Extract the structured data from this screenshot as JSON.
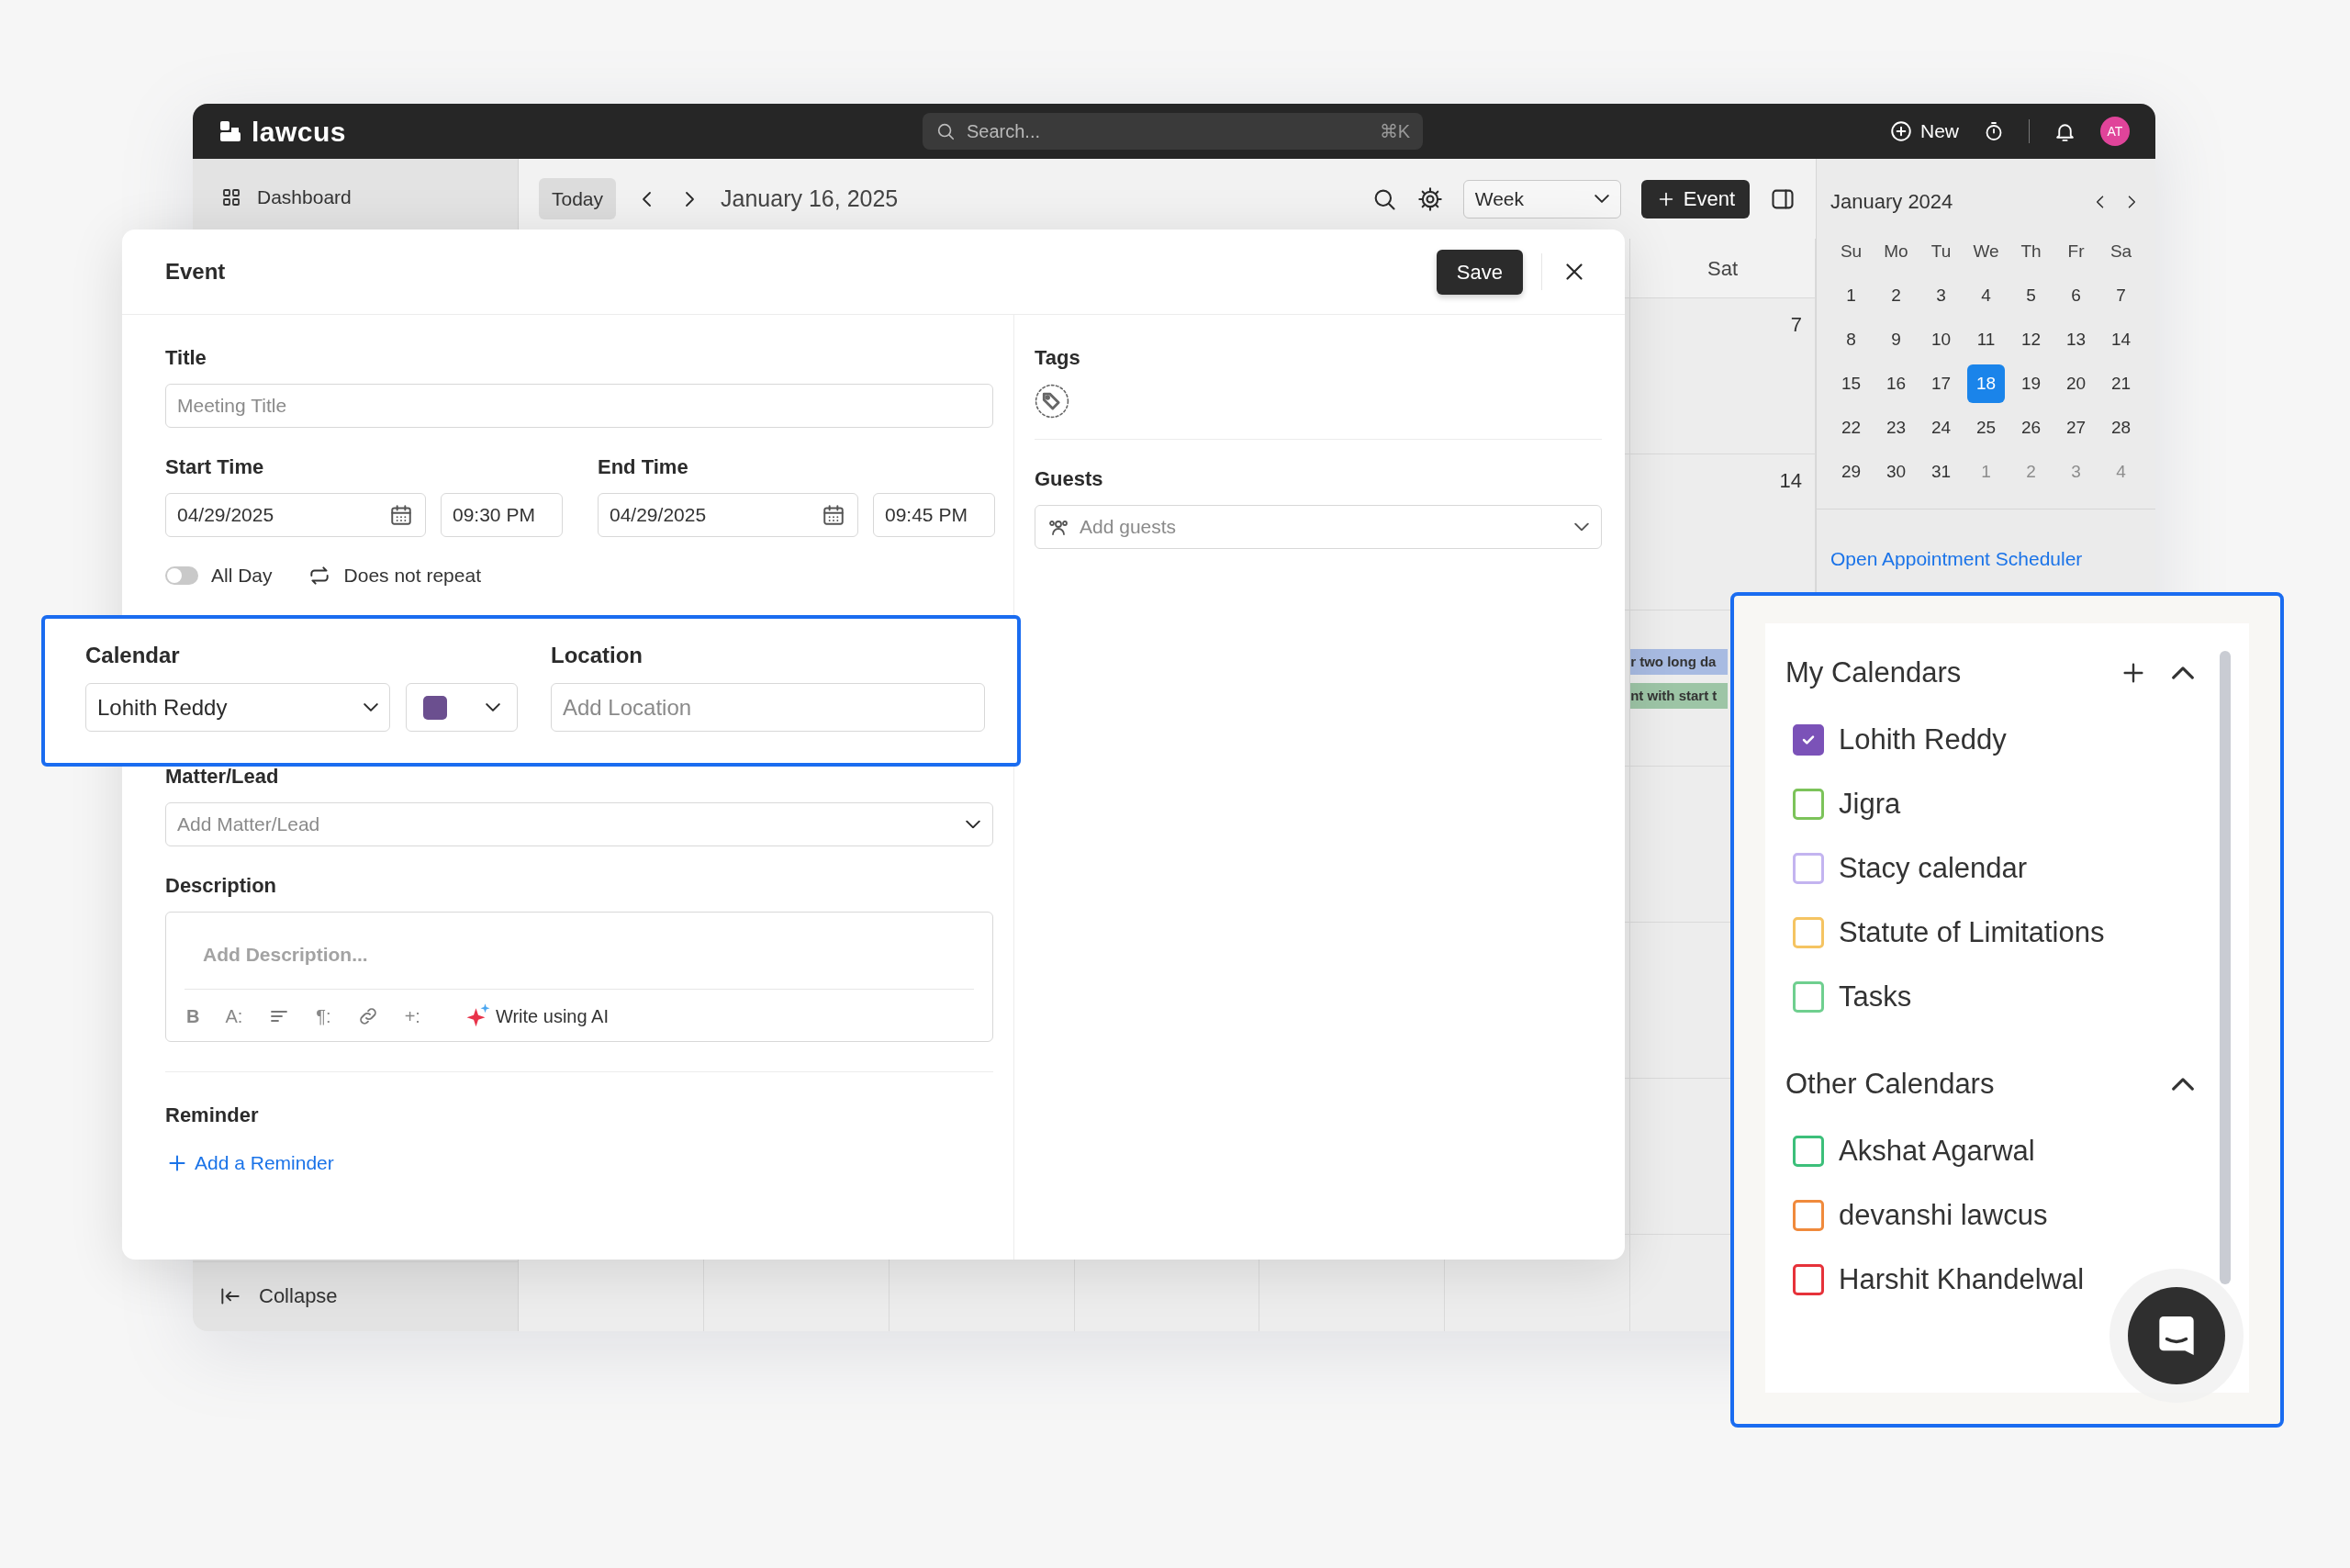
{
  "app": {
    "logo": "lawcus",
    "search": {
      "placeholder": "Search...",
      "shortcut": "⌘K"
    },
    "new_label": "New",
    "avatar": "AT"
  },
  "sidebar": {
    "items": [
      {
        "label": "Dashboard"
      }
    ],
    "collapse": "Collapse"
  },
  "toolbar": {
    "today": "Today",
    "date": "January 16, 2025",
    "view": "Week",
    "add_event": "Event"
  },
  "week": {
    "day_header": "Sat",
    "dates": [
      "7",
      "14"
    ],
    "events": [
      {
        "text": "r two long da",
        "color": "#a8bbe2"
      },
      {
        "text": "nt with start t",
        "color": "#9dc5a6"
      }
    ]
  },
  "mini_calendar": {
    "month": "January 2024",
    "weekdays": [
      "Su",
      "Mo",
      "Tu",
      "We",
      "Th",
      "Fr",
      "Sa"
    ],
    "days": [
      {
        "label": "1",
        "outside": false,
        "selected": false
      },
      {
        "label": "2",
        "outside": false,
        "selected": false
      },
      {
        "label": "3",
        "outside": false,
        "selected": false
      },
      {
        "label": "4",
        "outside": false,
        "selected": false
      },
      {
        "label": "5",
        "outside": false,
        "selected": false
      },
      {
        "label": "6",
        "outside": false,
        "selected": false
      },
      {
        "label": "7",
        "outside": false,
        "selected": false
      },
      {
        "label": "8",
        "outside": false,
        "selected": false
      },
      {
        "label": "9",
        "outside": false,
        "selected": false
      },
      {
        "label": "10",
        "outside": false,
        "selected": false
      },
      {
        "label": "11",
        "outside": false,
        "selected": false
      },
      {
        "label": "12",
        "outside": false,
        "selected": false
      },
      {
        "label": "13",
        "outside": false,
        "selected": false
      },
      {
        "label": "14",
        "outside": false,
        "selected": false
      },
      {
        "label": "15",
        "outside": false,
        "selected": false
      },
      {
        "label": "16",
        "outside": false,
        "selected": false
      },
      {
        "label": "17",
        "outside": false,
        "selected": false
      },
      {
        "label": "18",
        "outside": false,
        "selected": true
      },
      {
        "label": "19",
        "outside": false,
        "selected": false
      },
      {
        "label": "20",
        "outside": false,
        "selected": false
      },
      {
        "label": "21",
        "outside": false,
        "selected": false
      },
      {
        "label": "22",
        "outside": false,
        "selected": false
      },
      {
        "label": "23",
        "outside": false,
        "selected": false
      },
      {
        "label": "24",
        "outside": false,
        "selected": false
      },
      {
        "label": "25",
        "outside": false,
        "selected": false
      },
      {
        "label": "26",
        "outside": false,
        "selected": false
      },
      {
        "label": "27",
        "outside": false,
        "selected": false
      },
      {
        "label": "28",
        "outside": false,
        "selected": false
      },
      {
        "label": "29",
        "outside": false,
        "selected": false
      },
      {
        "label": "30",
        "outside": false,
        "selected": false
      },
      {
        "label": "31",
        "outside": false,
        "selected": false
      },
      {
        "label": "1",
        "outside": true,
        "selected": false
      },
      {
        "label": "2",
        "outside": true,
        "selected": false
      },
      {
        "label": "3",
        "outside": true,
        "selected": false
      },
      {
        "label": "4",
        "outside": true,
        "selected": false
      }
    ],
    "link": "Open Appointment Scheduler"
  },
  "event_modal": {
    "heading": "Event",
    "save": "Save",
    "title_field": {
      "label": "Title",
      "placeholder": "Meeting Title"
    },
    "start": {
      "label": "Start Time",
      "date": "04/29/2025",
      "time": "09:30 PM"
    },
    "end": {
      "label": "End Time",
      "date": "04/29/2025",
      "time": "09:45 PM"
    },
    "all_day": {
      "label": "All Day",
      "on": false
    },
    "repeat": "Does not repeat",
    "matter": {
      "label": "Matter/Lead",
      "placeholder": "Add Matter/Lead"
    },
    "description": {
      "label": "Description",
      "placeholder": "Add Description...",
      "ai_label": "Write using AI",
      "tools": [
        {
          "kind": "bold",
          "label": "B"
        },
        {
          "kind": "font",
          "label": "A:"
        },
        {
          "kind": "align"
        },
        {
          "kind": "paragraph",
          "label": "¶:"
        },
        {
          "kind": "link"
        },
        {
          "kind": "insert",
          "label": "+:"
        }
      ]
    },
    "reminder": {
      "label": "Reminder",
      "action": "Add a Reminder"
    },
    "tags": {
      "label": "Tags"
    },
    "guests": {
      "label": "Guests",
      "placeholder": "Add guests"
    }
  },
  "calendar_callout": {
    "calendar": {
      "label": "Calendar",
      "value": "Lohith Reddy"
    },
    "color": "#6b4f8f",
    "location": {
      "label": "Location",
      "placeholder": "Add Location"
    }
  },
  "calendars_panel": {
    "sections": [
      {
        "title": "My Calendars",
        "addable": true,
        "expanded": true,
        "items": [
          {
            "label": "Lohith Reddy",
            "checked": true,
            "color": "#7b52b8"
          },
          {
            "label": "Jigra",
            "checked": false,
            "color": "#7cc35a"
          },
          {
            "label": "Stacy calendar",
            "checked": false,
            "color": "#c3b4f0"
          },
          {
            "label": "Statute of Limitations",
            "checked": false,
            "color": "#f5c462"
          },
          {
            "label": "Tasks",
            "checked": false,
            "color": "#6fcf8f"
          }
        ]
      },
      {
        "title": "Other Calendars",
        "addable": false,
        "expanded": true,
        "items": [
          {
            "label": "Akshat Agarwal",
            "checked": false,
            "color": "#3cbf7a"
          },
          {
            "label": "devanshi lawcus",
            "checked": false,
            "color": "#f08a3c"
          },
          {
            "label": "Harshit Khandelwal",
            "checked": false,
            "color": "#e6323a"
          }
        ]
      }
    ]
  }
}
